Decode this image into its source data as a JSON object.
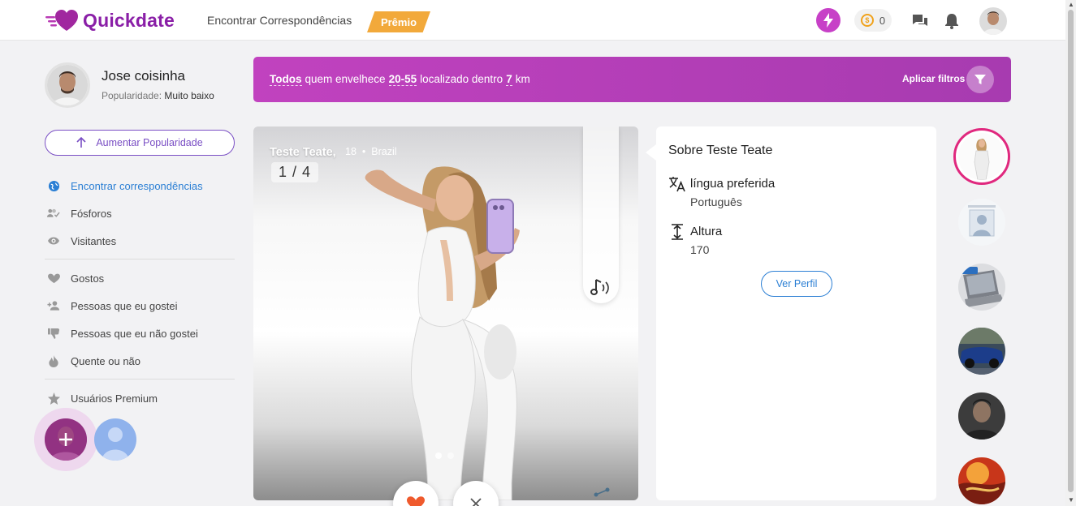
{
  "header": {
    "logo_text": "Quickdate",
    "nav_link": "Encontrar Correspondências",
    "premium_label": "Prêmio",
    "credits": "0"
  },
  "sidebar": {
    "user_name": "Jose coisinha",
    "popularity_label": "Popularidade:",
    "popularity_value": "Muito baixo",
    "boost_label": "Aumentar Popularidade",
    "menu": [
      {
        "label": "Encontrar correspondências",
        "icon": "globe-icon",
        "active": true
      },
      {
        "label": "Fósforos",
        "icon": "users-check-icon"
      },
      {
        "label": "Visitantes",
        "icon": "eye-icon"
      },
      {
        "label": "Gostos",
        "icon": "heart-icon"
      },
      {
        "label": "Pessoas que eu gostei",
        "icon": "user-plus-icon"
      },
      {
        "label": "Pessoas que eu não gostei",
        "icon": "thumbs-down-icon"
      },
      {
        "label": "Quente ou não",
        "icon": "fire-icon"
      },
      {
        "label": "Usuários Premium",
        "icon": "star-icon"
      }
    ]
  },
  "filters": {
    "who": "Todos",
    "text1": "quem envelhece",
    "age_range": "20-55",
    "text2": "localizado dentro",
    "distance": "7",
    "unit": "km",
    "apply_label": "Aplicar filtros"
  },
  "card": {
    "name": "Teste Teate,",
    "age": "18",
    "separator": "•",
    "country": "Brazil",
    "counter": "1 / 4"
  },
  "about": {
    "title": "Sobre Teste Teate",
    "language_label": "língua preferida",
    "language_value": "Português",
    "height_label": "Altura",
    "height_value": "170",
    "view_profile_label": "Ver Perfil"
  },
  "colors": {
    "brand": "#8a1fa7",
    "accent_blue": "#2b7fd4",
    "filter_bar": "#b83db8",
    "premium": "#f2a93b",
    "active_ring": "#e0287e"
  }
}
